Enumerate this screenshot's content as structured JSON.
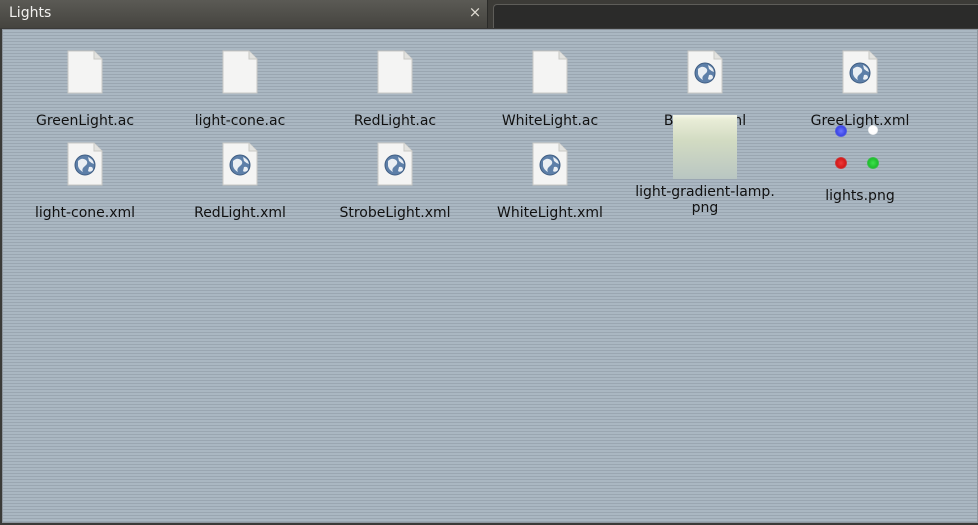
{
  "window": {
    "active_tab_title": "Lights",
    "close_glyph": "×"
  },
  "files": [
    {
      "name": "GreenLight.ac",
      "icon": "document-icon"
    },
    {
      "name": "light-cone.ac",
      "icon": "document-icon"
    },
    {
      "name": "RedLight.ac",
      "icon": "document-icon"
    },
    {
      "name": "WhiteLight.ac",
      "icon": "document-icon"
    },
    {
      "name": "Beacon.xml",
      "icon": "xml-globe-icon"
    },
    {
      "name": "GreeLight.xml",
      "icon": "xml-globe-icon"
    },
    {
      "name": "light-cone.xml",
      "icon": "xml-globe-icon"
    },
    {
      "name": "RedLight.xml",
      "icon": "xml-globe-icon"
    },
    {
      "name": "StrobeLight.xml",
      "icon": "xml-globe-icon"
    },
    {
      "name": "WhiteLight.xml",
      "icon": "xml-globe-icon"
    },
    {
      "name": "light-gradient-lamp.\npng",
      "icon": "gradient-thumbnail"
    },
    {
      "name": "lights.png",
      "icon": "lights-thumbnail"
    }
  ],
  "colors": {
    "blue_light": "#3c46e6",
    "white_light": "#ffffff",
    "red_light": "#d41a1a",
    "green_light": "#1fbf2e"
  }
}
